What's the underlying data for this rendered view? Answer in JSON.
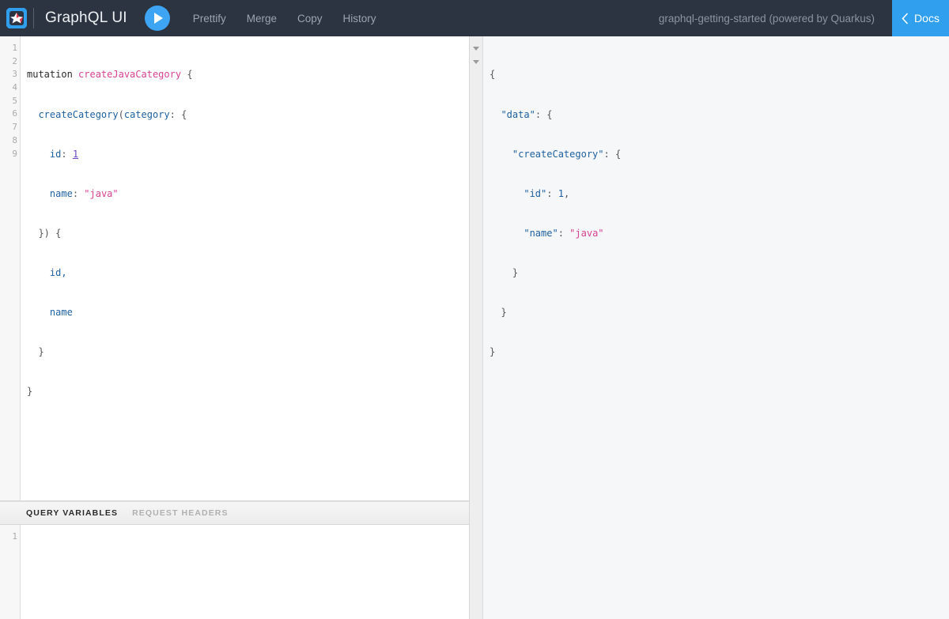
{
  "header": {
    "logo_icon": "quarkus-logo-icon",
    "title": "GraphQL UI",
    "execute_icon": "play-icon",
    "buttons": [
      {
        "label": "Prettify",
        "name": "prettify-button"
      },
      {
        "label": "Merge",
        "name": "merge-button"
      },
      {
        "label": "Copy",
        "name": "copy-button"
      },
      {
        "label": "History",
        "name": "history-button"
      }
    ],
    "endpoint_label": "graphql-getting-started (powered by Quarkus)",
    "docs_label": "Docs",
    "docs_icon": "chevron-left-icon"
  },
  "query_editor": {
    "line_numbers": [
      "1",
      "2",
      "3",
      "4",
      "5",
      "6",
      "7",
      "8",
      "9"
    ],
    "lines": [
      "mutation createJavaCategory {",
      "  createCategory(category: {",
      "    id: 1",
      "    name: \"java\"",
      "  }) {",
      "    id,",
      "    name",
      "  }",
      "}"
    ],
    "tokens": {
      "keyword": "mutation",
      "operation_name": "createJavaCategory",
      "field": "createCategory",
      "arg": "category",
      "id_field": "id",
      "id_value": "1",
      "name_field": "name",
      "name_value": "\"java\"",
      "sel_id": "id,",
      "sel_name": "name"
    }
  },
  "variables_panel": {
    "tabs": [
      {
        "label": "QUERY VARIABLES",
        "active": true
      },
      {
        "label": "REQUEST HEADERS",
        "active": false
      }
    ],
    "line_numbers": [
      "1"
    ],
    "content": ""
  },
  "result_panel": {
    "fold_rows": [
      0,
      1
    ],
    "lines": [
      "{",
      "  \"data\": {",
      "    \"createCategory\": {",
      "      \"id\": 1,",
      "      \"name\": \"java\"",
      "    }",
      "  }",
      "}"
    ],
    "tokens": {
      "data_key": "\"data\"",
      "create_key": "\"createCategory\"",
      "id_key": "\"id\"",
      "id_value": "1",
      "name_key": "\"name\"",
      "name_value": "\"java\""
    }
  },
  "colors": {
    "topbar_bg": "#2b3440",
    "accent_blue": "#3da5f4",
    "docs_blue": "#2f9fee",
    "string_magenta": "#d64292",
    "field_blue": "#1f61a0",
    "number_purple": "#6b48c8",
    "result_bg": "#f6f7f8"
  }
}
